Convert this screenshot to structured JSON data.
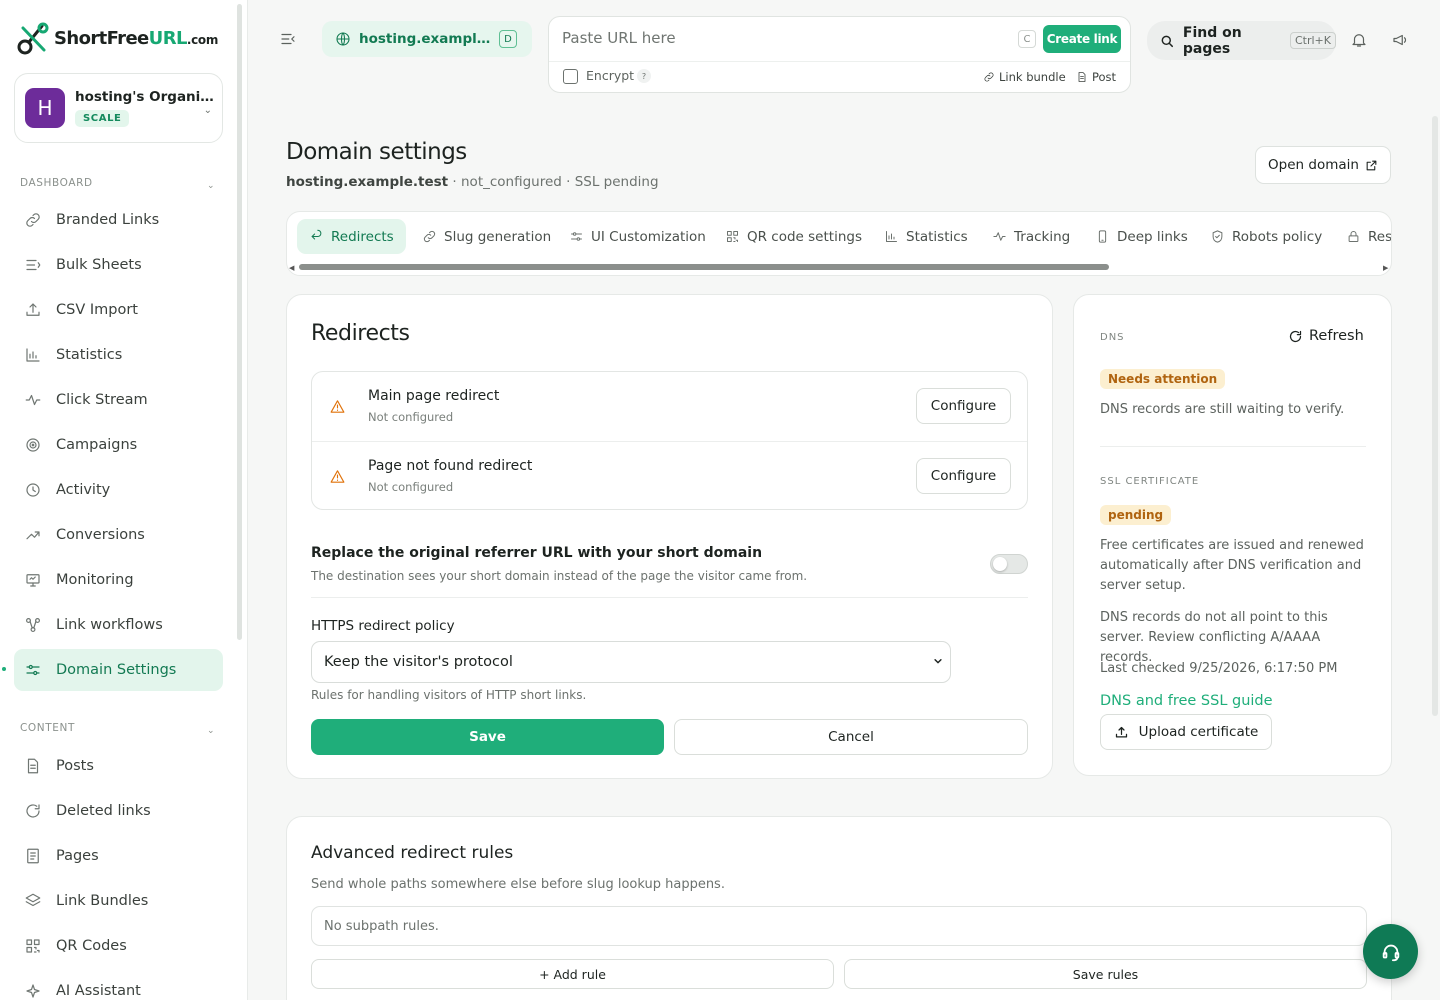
{
  "brand": {
    "name_part1": "ShortFree",
    "name_part2": "URL",
    "name_part3": ".com",
    "accent": "#1fae7a"
  },
  "org": {
    "avatar_letter": "H",
    "name": "hosting's Organi…",
    "plan": "SCALE"
  },
  "sidebar": {
    "dashboard_label": "DASHBOARD",
    "content_label": "CONTENT",
    "items": [
      {
        "label": "Branded Links",
        "icon": "link-icon"
      },
      {
        "label": "Bulk Sheets",
        "icon": "list-icon"
      },
      {
        "label": "CSV Import",
        "icon": "upload-icon"
      },
      {
        "label": "Statistics",
        "icon": "bar-chart-icon"
      },
      {
        "label": "Click Stream",
        "icon": "pulse-icon"
      },
      {
        "label": "Campaigns",
        "icon": "target-icon"
      },
      {
        "label": "Activity",
        "icon": "clock-icon"
      },
      {
        "label": "Conversions",
        "icon": "trend-icon"
      },
      {
        "label": "Monitoring",
        "icon": "monitor-icon"
      },
      {
        "label": "Link workflows",
        "icon": "workflow-icon"
      },
      {
        "label": "Domain Settings",
        "icon": "sliders-icon",
        "active": true
      }
    ],
    "content_items": [
      {
        "label": "Posts",
        "icon": "document-icon"
      },
      {
        "label": "Deleted links",
        "icon": "refresh-icon"
      },
      {
        "label": "Pages",
        "icon": "page-icon"
      },
      {
        "label": "Link Bundles",
        "icon": "layers-icon"
      },
      {
        "label": "QR Codes",
        "icon": "qr-icon"
      },
      {
        "label": "AI Assistant",
        "icon": "sparkle-icon"
      }
    ]
  },
  "topbar": {
    "domain_chip": "hosting.example.te…",
    "domain_badge": "D",
    "url_placeholder": "Paste URL here",
    "c_key": "C",
    "create_label": "Create link",
    "encrypt_label": "Encrypt",
    "encrypt_help": "?",
    "link_bundle_label": "Link bundle",
    "post_label": "Post",
    "find_label": "Find on pages",
    "find_shortcut": "Ctrl+K"
  },
  "page": {
    "title": "Domain settings",
    "domain": "hosting.example.test",
    "status": " · not_configured · SSL pending",
    "open_domain": "Open domain"
  },
  "tabs": [
    {
      "label": "Redirects",
      "icon": "redirect-icon",
      "active": true
    },
    {
      "label": "Slug generation",
      "icon": "link-icon"
    },
    {
      "label": "UI Customization",
      "icon": "sliders-icon"
    },
    {
      "label": "QR code settings",
      "icon": "qr-icon"
    },
    {
      "label": "Statistics",
      "icon": "bar-chart-icon"
    },
    {
      "label": "Tracking",
      "icon": "pulse-icon"
    },
    {
      "label": "Deep links",
      "icon": "phone-icon"
    },
    {
      "label": "Robots policy",
      "icon": "shield-icon"
    },
    {
      "label": "Rest",
      "icon": "lock-icon"
    }
  ],
  "redirects": {
    "title": "Redirects",
    "rows": [
      {
        "title": "Main page redirect",
        "status": "Not configured",
        "button": "Configure"
      },
      {
        "title": "Page not found redirect",
        "status": "Not configured",
        "button": "Configure"
      }
    ],
    "referrer_title": "Replace the original referrer URL with your short domain",
    "referrer_desc": "The destination sees your short domain instead of the page the visitor came from.",
    "https_label": "HTTPS redirect policy",
    "https_value": "Keep the visitor's protocol",
    "https_help": "Rules for handling visitors of HTTP short links.",
    "save": "Save",
    "cancel": "Cancel"
  },
  "dns": {
    "label": "DNS",
    "refresh": "Refresh",
    "status": "Needs attention",
    "status_text": "DNS records are still waiting to verify.",
    "ssl_label": "SSL CERTIFICATE",
    "ssl_status": "pending",
    "ssl_text": "Free certificates are issued and renewed automatically after DNS verification and server setup.",
    "conflict_text": "DNS records do not all point to this server. Review conflicting A/AAAA records.",
    "last_checked": "Last checked 9/25/2026, 6:17:50 PM",
    "guide": "DNS and free SSL guide",
    "upload": "Upload certificate"
  },
  "advanced": {
    "title": "Advanced redirect rules",
    "desc": "Send whole paths somewhere else before slug lookup happens.",
    "empty": "No subpath rules.",
    "add_rule": "+ Add rule",
    "save_rules": "Save rules"
  }
}
